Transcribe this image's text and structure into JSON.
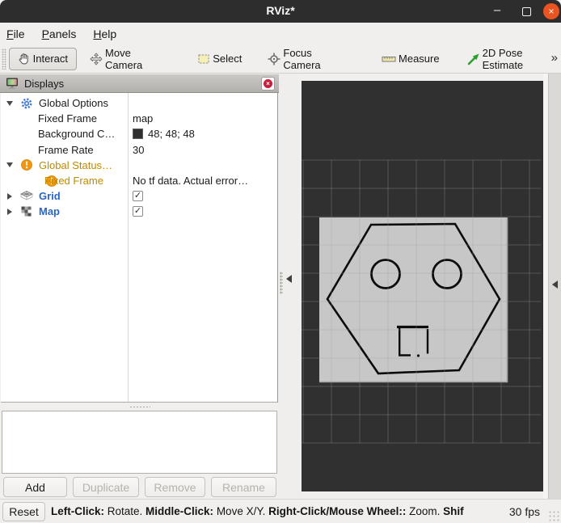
{
  "window": {
    "title": "RViz*"
  },
  "window_controls": {
    "minimize": "–",
    "close": "×"
  },
  "menu": {
    "items": [
      {
        "label": "File"
      },
      {
        "label": "Panels"
      },
      {
        "label": "Help"
      }
    ]
  },
  "toolbar": {
    "tools": [
      {
        "label": "Interact",
        "icon": "hand-icon",
        "active": true
      },
      {
        "label": "Move Camera",
        "icon": "move-arrows-icon",
        "active": false
      },
      {
        "label": "Select",
        "icon": "selection-box-icon",
        "active": false
      },
      {
        "label": "Focus Camera",
        "icon": "crosshair-icon",
        "active": false
      },
      {
        "label": "Measure",
        "icon": "ruler-icon",
        "active": false
      },
      {
        "label": "2D Pose Estimate",
        "icon": "green-arrow-icon",
        "active": false
      }
    ],
    "overflow": "»"
  },
  "displays": {
    "title": "Displays",
    "rows": [
      {
        "label": "Global Options",
        "value": ""
      },
      {
        "label": "Fixed Frame",
        "value": "map"
      },
      {
        "label": "Background C…",
        "value": "48; 48; 48"
      },
      {
        "label": "Frame Rate",
        "value": "30"
      },
      {
        "label": "Global Status…",
        "value": ""
      },
      {
        "label": "Fixed Frame",
        "value": "No tf data.  Actual error…"
      },
      {
        "label": "Grid",
        "checked": "✓"
      },
      {
        "label": "Map",
        "checked": "✓"
      }
    ]
  },
  "panel_buttons": {
    "add": "Add",
    "duplicate": "Duplicate",
    "remove": "Remove",
    "rename": "Rename"
  },
  "statusbar": {
    "reset": "Reset",
    "segments": [
      {
        "text": "Left-Click:"
      },
      {
        "text": " Rotate. "
      },
      {
        "text": "Middle-Click:"
      },
      {
        "text": " Move X/Y. "
      },
      {
        "text": "Right-Click/Mouse Wheel::"
      },
      {
        "text": " Zoom. "
      },
      {
        "text": "Shif"
      }
    ],
    "fps": "30 fps"
  },
  "colors": {
    "titlebar_bg": "#2d2d2d",
    "ubuntu_close": "#e95420",
    "view_background": "#303030",
    "map_gray": "#c7c7c7",
    "warning_text": "#c08a00",
    "warning_icon": "#ef9711",
    "display_name_blue": "#2a66c8",
    "grid_line": "#9a9a9e"
  }
}
